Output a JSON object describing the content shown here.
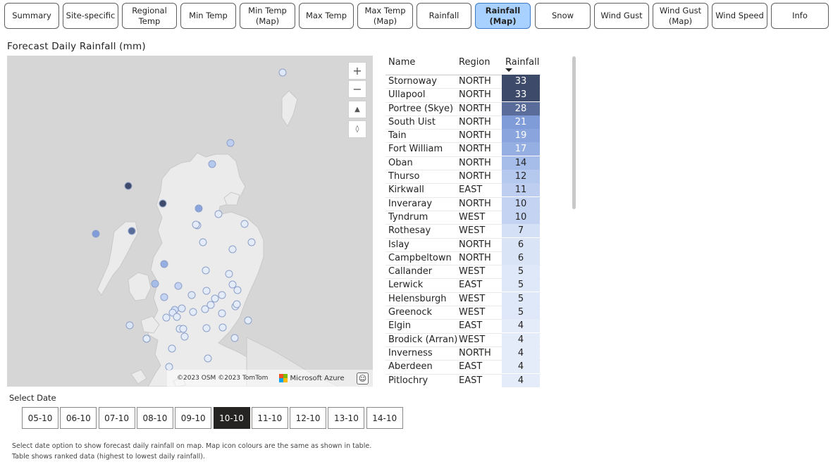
{
  "tabs": [
    {
      "label": "Summary"
    },
    {
      "label": "Site-specific"
    },
    {
      "label": "Regional\nTemp"
    },
    {
      "label": "Min Temp"
    },
    {
      "label": "Min Temp\n(Map)"
    },
    {
      "label": "Max Temp"
    },
    {
      "label": "Max Temp\n(Map)"
    },
    {
      "label": "Rainfall"
    },
    {
      "label": "Rainfall\n(Map)",
      "active": true
    },
    {
      "label": "Snow"
    },
    {
      "label": "Wind Gust"
    },
    {
      "label": "Wind Gust\n(Map)"
    },
    {
      "label": "Wind Speed"
    },
    {
      "label": "Info"
    }
  ],
  "title": "Forecast Daily Rainfall (mm)",
  "map": {
    "zoom_in": "+",
    "zoom_out": "−",
    "attribution": "©2023 OSM ©2023 TomTom",
    "provider": "Microsoft Azure",
    "feedback_icon": "smiley-icon"
  },
  "table": {
    "headers": {
      "name": "Name",
      "region": "Region",
      "rainfall": "Rainfall"
    },
    "sort": "rainfall-descending",
    "rows": [
      {
        "name": "Stornoway",
        "region": "NORTH",
        "rainfall": "33"
      },
      {
        "name": "Ullapool",
        "region": "NORTH",
        "rainfall": "33"
      },
      {
        "name": "Portree (Skye)",
        "region": "NORTH",
        "rainfall": "28"
      },
      {
        "name": "South Uist",
        "region": "NORTH",
        "rainfall": "21"
      },
      {
        "name": "Tain",
        "region": "NORTH",
        "rainfall": "19"
      },
      {
        "name": "Fort William",
        "region": "NORTH",
        "rainfall": "17"
      },
      {
        "name": "Oban",
        "region": "NORTH",
        "rainfall": "14"
      },
      {
        "name": "Thurso",
        "region": "NORTH",
        "rainfall": "12"
      },
      {
        "name": "Kirkwall",
        "region": "EAST",
        "rainfall": "11"
      },
      {
        "name": "Inveraray",
        "region": "NORTH",
        "rainfall": "10"
      },
      {
        "name": "Tyndrum",
        "region": "WEST",
        "rainfall": "10"
      },
      {
        "name": "Rothesay",
        "region": "WEST",
        "rainfall": "7"
      },
      {
        "name": "Islay",
        "region": "NORTH",
        "rainfall": "6"
      },
      {
        "name": "Campbeltown",
        "region": "NORTH",
        "rainfall": "6"
      },
      {
        "name": "Callander",
        "region": "WEST",
        "rainfall": "5"
      },
      {
        "name": "Lerwick",
        "region": "EAST",
        "rainfall": "5"
      },
      {
        "name": "Helensburgh",
        "region": "WEST",
        "rainfall": "5"
      },
      {
        "name": "Greenock",
        "region": "WEST",
        "rainfall": "5"
      },
      {
        "name": "Elgin",
        "region": "EAST",
        "rainfall": "4"
      },
      {
        "name": "Brodick (Arran)",
        "region": "WEST",
        "rainfall": "4"
      },
      {
        "name": "Inverness",
        "region": "NORTH",
        "rainfall": "4"
      },
      {
        "name": "Aberdeen",
        "region": "EAST",
        "rainfall": "4"
      },
      {
        "name": "Pitlochry",
        "region": "EAST",
        "rainfall": "4"
      }
    ]
  },
  "select_date": {
    "label": "Select Date",
    "options": [
      "05-10",
      "06-10",
      "07-10",
      "08-10",
      "09-10",
      "10-10",
      "11-10",
      "12-10",
      "13-10",
      "14-10"
    ],
    "selected": "10-10"
  },
  "note": {
    "line1": "Select date option to show forecast daily rainfall on map. Map icon colours are the same as shown in table.",
    "line2": "Table shows ranked data (highest to lowest daily rainfall)."
  },
  "colors": {
    "active_tab": "#a9d1ff",
    "scale_high": "#3d4a69",
    "scale_low": "#e4ecf9",
    "map_land": "#ebebeb",
    "map_sea": "#d6d6d6"
  }
}
